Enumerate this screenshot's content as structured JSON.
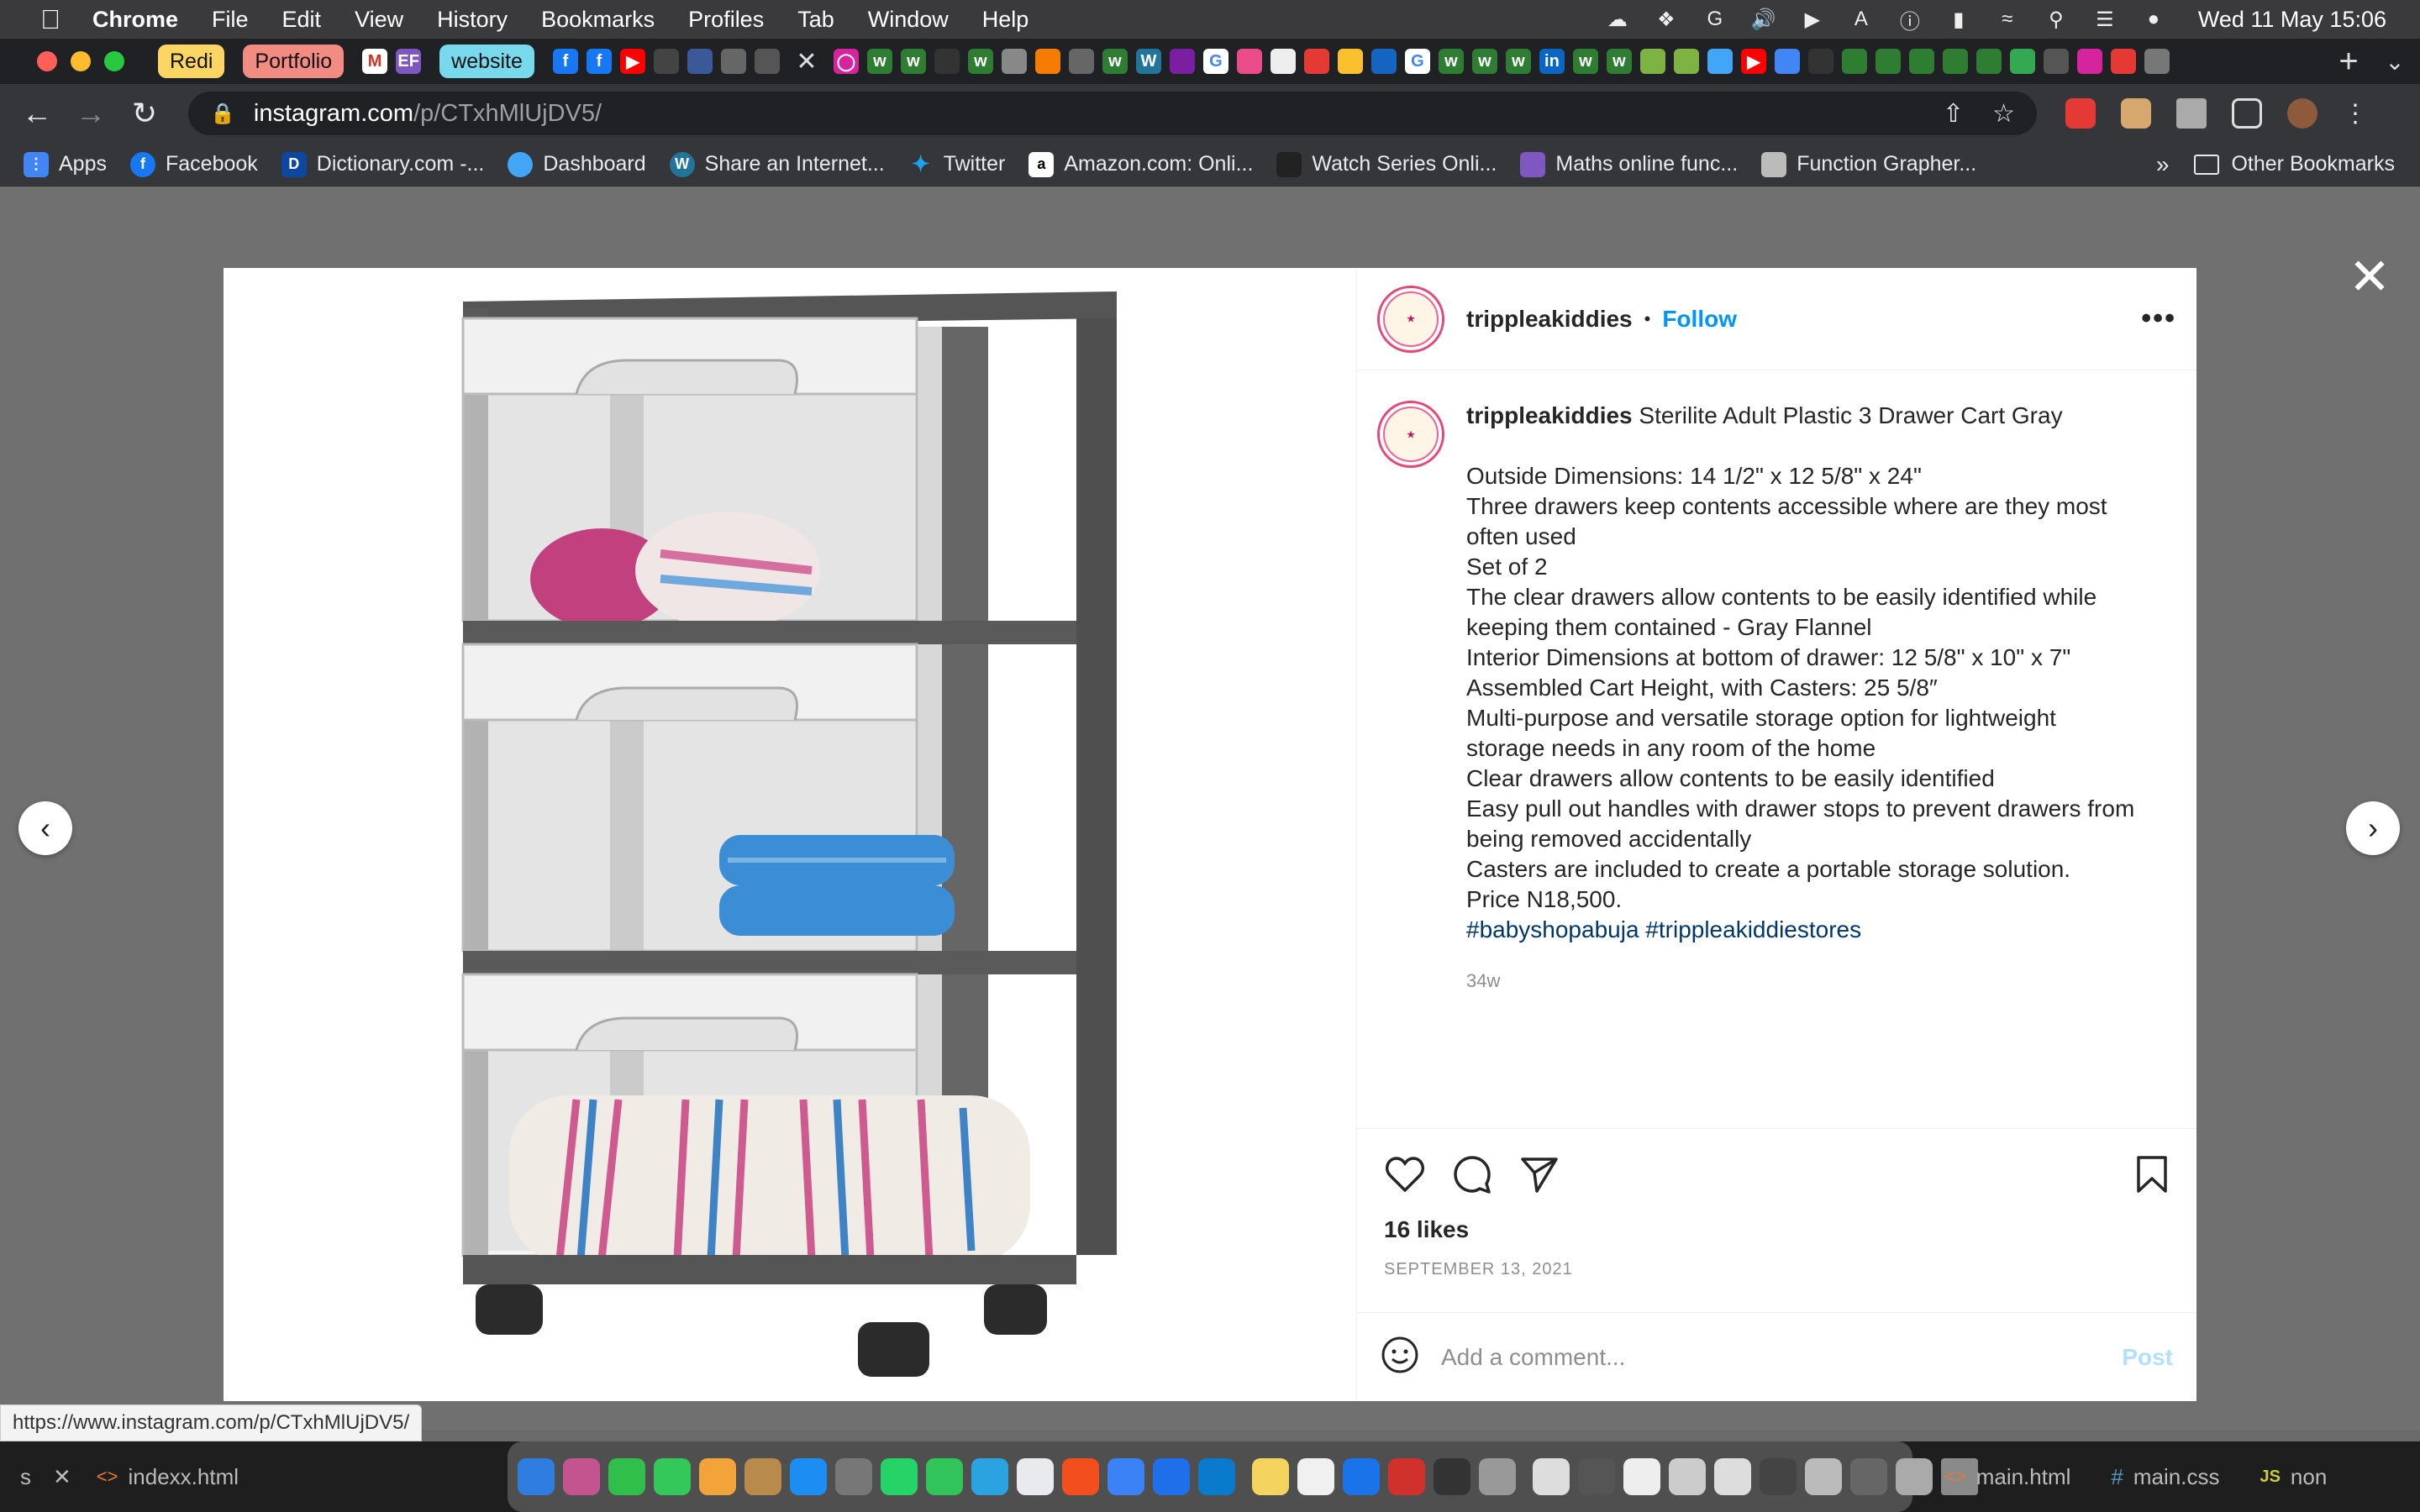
{
  "menubar": {
    "app_name": "Chrome",
    "menus": [
      "File",
      "Edit",
      "View",
      "History",
      "Bookmarks",
      "Profiles",
      "Tab",
      "Window",
      "Help"
    ],
    "clock": "Wed 11 May  15:06"
  },
  "tabs": {
    "groups": [
      {
        "label": "Redi",
        "color": "#fcd663"
      },
      {
        "label": "Portfolio",
        "color": "#f28b82"
      },
      {
        "label": "website",
        "color": "#78d9ec"
      }
    ]
  },
  "toolbar": {
    "url_host": "instagram.com",
    "url_path": "/p/CTxhMlUjDV5/"
  },
  "bookmarks": {
    "items": [
      "Apps",
      "Facebook",
      "Dictionary.com -...",
      "Dashboard",
      "Share an Internet...",
      "Twitter",
      "Amazon.com: Onli...",
      "Watch Series Onli...",
      "Maths online func...",
      "Function Grapher..."
    ],
    "more": "»",
    "other": "Other Bookmarks"
  },
  "post": {
    "username": "trippleakiddies",
    "follow_label": "Follow",
    "dot": "•",
    "caption_title": "Sterilite Adult Plastic 3 Drawer Cart Gray",
    "caption_lines": [
      "Outside Dimensions: 14 1/2\" x 12 5/8\" x 24\"",
      "Three drawers keep contents accessible where are they most",
      "often used",
      "Set of 2",
      "The clear drawers allow contents to be easily identified while",
      "keeping them contained - Gray Flannel",
      "Interior Dimensions at bottom of drawer: 12 5/8\" x 10\" x 7\"",
      "Assembled Cart Height, with Casters: 25 5/8″",
      "Multi-purpose and versatile storage option for lightweight",
      "storage needs in any room of the home",
      "Clear drawers allow contents to be easily identified",
      "Easy pull out handles with drawer stops to prevent drawers from",
      "being removed accidentally",
      "Casters are included to create a portable storage solution.",
      "Price N18,500."
    ],
    "hashtags": "#babyshopabuja #trippleakiddiestores",
    "age": "34w",
    "likes": "16 likes",
    "date": "SEPTEMBER 13, 2021",
    "comment_placeholder": "Add a comment...",
    "post_label": "Post"
  },
  "status_url": "https://www.instagram.com/p/CTxhMlUjDV5/",
  "bottom": {
    "left_tab": "indexx.html",
    "right_tabs": [
      "main.html",
      "main.css",
      "non"
    ]
  }
}
